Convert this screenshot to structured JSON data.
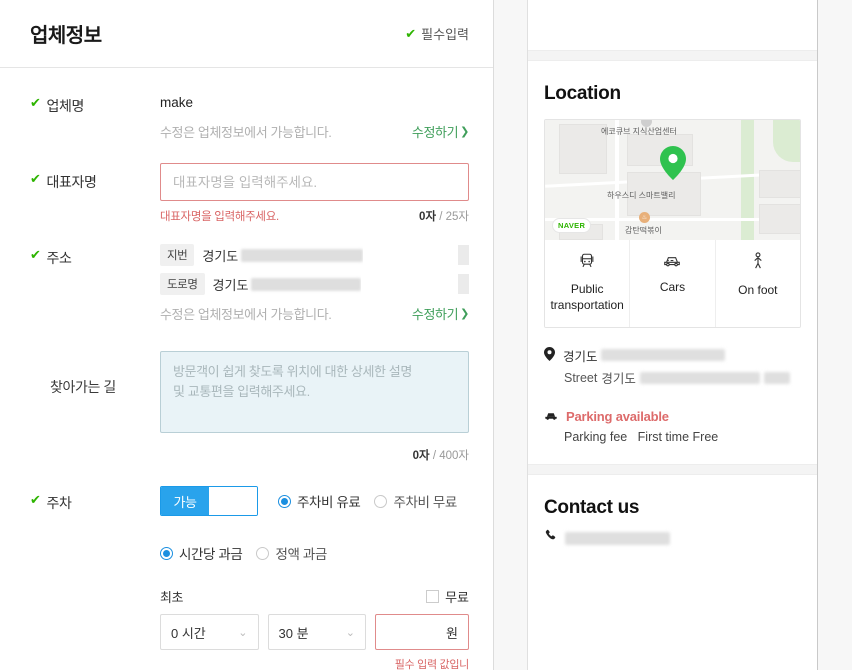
{
  "form": {
    "title": "업체정보",
    "required_note": "필수입력",
    "rows": {
      "company_name": {
        "label": "업체명",
        "value": "make",
        "hint": "수정은 업체정보에서 가능합니다.",
        "edit_link": "수정하기",
        "chevron": "❯"
      },
      "representative": {
        "label": "대표자명",
        "placeholder": "대표자명을 입력해주세요.",
        "value": "",
        "error": "대표자명을 입력해주세요.",
        "counter_current": "0자",
        "counter_max": "/ 25자"
      },
      "address": {
        "label": "주소",
        "lot_tag": "지번",
        "lot_value": "경기도 ",
        "road_tag": "도로명",
        "road_value": "경기도 ",
        "hint": "수정은 업체정보에서 가능합니다.",
        "edit_link": "수정하기",
        "chevron": "❯"
      },
      "directions": {
        "label": "찾아가는 길",
        "placeholder": "방문객이 쉽게 찾도록 위치에 대한 상세한 설명\n및 교통편을 입력해주세요.",
        "value": "",
        "counter_current": "0자",
        "counter_max": "/ 400자"
      },
      "parking": {
        "label": "주차",
        "toggle_on_label": "가능",
        "fee_radio": [
          {
            "label": "주차비 유료",
            "selected": true
          },
          {
            "label": "주차비 무료",
            "selected": false
          }
        ],
        "charge_radio": [
          {
            "label": "시간당 과금",
            "selected": true
          },
          {
            "label": "정액 과금",
            "selected": false
          }
        ],
        "first_label": "최초",
        "free_checkbox_label": "무료",
        "free_checked": false,
        "hour_select": "0 시간",
        "minute_select": "30 분",
        "won_unit": "원",
        "won_value": "",
        "won_error": "필수 입력 값입니"
      }
    }
  },
  "preview": {
    "location": {
      "heading": "Location",
      "map": {
        "naver_badge": "NAVER",
        "labels": [
          "에코큐브 지식산업센터",
          "하우스디 스마트밸리",
          "감탄떡볶이"
        ]
      },
      "tabs": [
        {
          "label": "Public transportation",
          "icon": "train-icon"
        },
        {
          "label": "Cars",
          "icon": "car-icon"
        },
        {
          "label": "On foot",
          "icon": "walk-icon"
        }
      ],
      "address_primary": "경기도 ",
      "address_secondary_prefix": "Street",
      "address_secondary": "경기도 ",
      "parking_status": "Parking available",
      "parking_fee_label": "Parking fee",
      "parking_fee_value": "First time Free"
    },
    "contact": {
      "heading": "Contact us",
      "phone": ""
    }
  },
  "colors": {
    "green": "#2db400",
    "link_green": "#3f9e5a",
    "blue": "#29a3ec",
    "error_red": "#d96666",
    "parking_red": "#dd6b6b"
  }
}
